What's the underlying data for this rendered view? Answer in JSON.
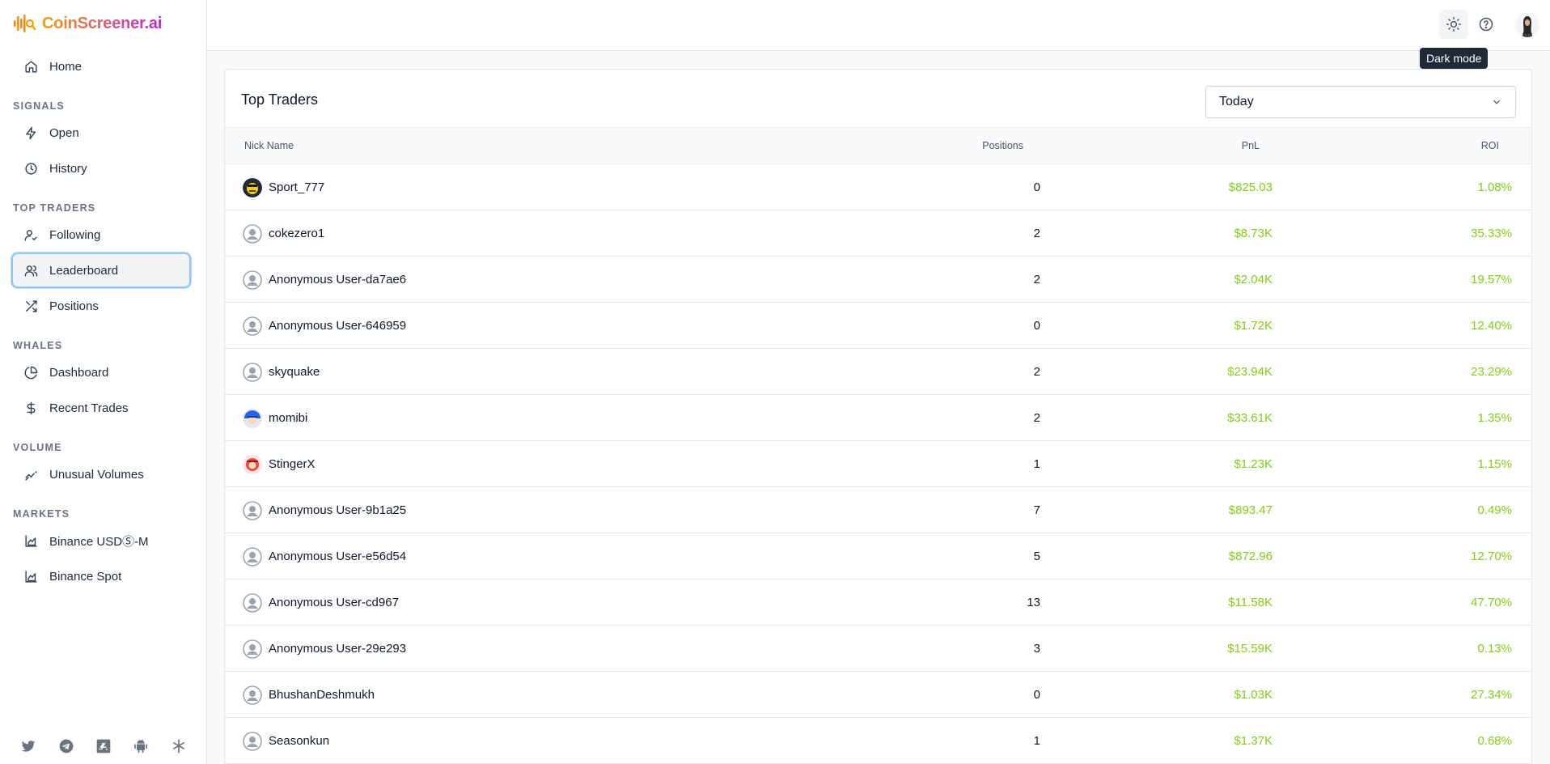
{
  "app": {
    "logo_text": "CoinScreener.ai"
  },
  "sidebar": {
    "home": "Home",
    "sections": {
      "signals": "SIGNALS",
      "top_traders": "TOP TRADERS",
      "whales": "WHALES",
      "volume": "VOLUME",
      "markets": "MARKETS"
    },
    "items": {
      "open": "Open",
      "history": "History",
      "following": "Following",
      "leaderboard": "Leaderboard",
      "positions": "Positions",
      "dashboard": "Dashboard",
      "recent_trades": "Recent Trades",
      "unusual_volumes": "Unusual Volumes",
      "binance_usdm": "Binance USDⓈ-M",
      "binance_spot": "Binance Spot"
    },
    "social_icons": [
      "twitter-icon",
      "telegram-icon",
      "app-store-icon",
      "android-icon",
      "asterisk-icon"
    ]
  },
  "topbar": {
    "icons": [
      "sun-icon",
      "help-icon",
      "user-avatar"
    ],
    "tooltip": "Dark mode"
  },
  "main": {
    "title": "Top Traders",
    "period_select": "Today",
    "columns": {
      "nick_name": "Nick Name",
      "positions": "Positions",
      "pnl": "PnL",
      "roi": "ROI"
    },
    "accent_color": "#84cc16",
    "rows": [
      {
        "name": "Sport_777",
        "positions": "0",
        "pnl": "$825.03",
        "roi": "1.08%",
        "avatar": "custom-avatar-yellow"
      },
      {
        "name": "cokezero1",
        "positions": "2",
        "pnl": "$8.73K",
        "roi": "35.33%",
        "avatar": "default-user"
      },
      {
        "name": "Anonymous User-da7ae6",
        "positions": "2",
        "pnl": "$2.04K",
        "roi": "19.57%",
        "avatar": "default-user"
      },
      {
        "name": "Anonymous User-646959",
        "positions": "0",
        "pnl": "$1.72K",
        "roi": "12.40%",
        "avatar": "default-user"
      },
      {
        "name": "skyquake",
        "positions": "2",
        "pnl": "$23.94K",
        "roi": "23.29%",
        "avatar": "default-user"
      },
      {
        "name": "momibi",
        "positions": "2",
        "pnl": "$33.61K",
        "roi": "1.35%",
        "avatar": "custom-avatar-blue"
      },
      {
        "name": "StingerX",
        "positions": "1",
        "pnl": "$1.23K",
        "roi": "1.15%",
        "avatar": "custom-avatar-red"
      },
      {
        "name": "Anonymous User-9b1a25",
        "positions": "7",
        "pnl": "$893.47",
        "roi": "0.49%",
        "avatar": "default-user"
      },
      {
        "name": "Anonymous User-e56d54",
        "positions": "5",
        "pnl": "$872.96",
        "roi": "12.70%",
        "avatar": "default-user"
      },
      {
        "name": "Anonymous User-cd967",
        "positions": "13",
        "pnl": "$11.58K",
        "roi": "47.70%",
        "avatar": "default-user"
      },
      {
        "name": "Anonymous User-29e293",
        "positions": "3",
        "pnl": "$15.59K",
        "roi": "0.13%",
        "avatar": "default-user"
      },
      {
        "name": "BhushanDeshmukh",
        "positions": "0",
        "pnl": "$1.03K",
        "roi": "27.34%",
        "avatar": "default-user"
      },
      {
        "name": "Seasonkun",
        "positions": "1",
        "pnl": "$1.37K",
        "roi": "0.68%",
        "avatar": "default-user"
      }
    ]
  }
}
